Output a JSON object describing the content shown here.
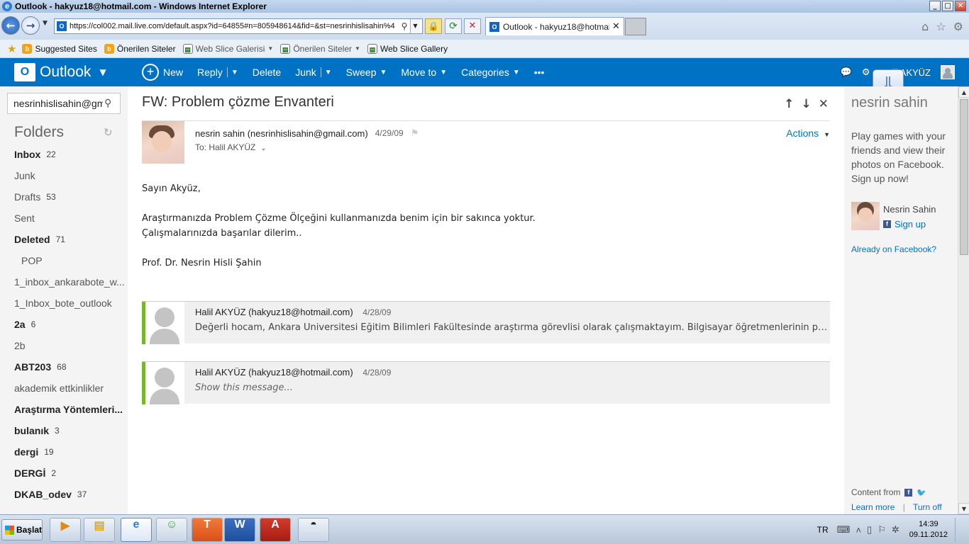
{
  "window": {
    "title": "Outlook - hakyuz18@hotmail.com - Windows Internet Explorer",
    "min": "_",
    "max": "□",
    "close": "✕"
  },
  "browser": {
    "url": "https://col002.mail.live.com/default.aspx?id=64855#n=805948614&fid=&st=nesrinhislisahin%4",
    "tab_label": "Outlook - hakyuz18@hotmail.com",
    "favorites": [
      {
        "label": "Suggested Sites",
        "icon": "bing-icon",
        "dropdown": false
      },
      {
        "label": "Önerilen Siteler",
        "icon": "bing-icon",
        "dropdown": false
      },
      {
        "label": "Web Slice Galerisi",
        "icon": "page-icon",
        "dropdown": true
      },
      {
        "label": "Önerilen Siteler",
        "icon": "page-icon",
        "dropdown": true
      },
      {
        "label": "Web Slice Gallery",
        "icon": "page-icon",
        "dropdown": false
      }
    ]
  },
  "appbar": {
    "brand": "Outlook",
    "commands": {
      "new": "New",
      "reply": "Reply",
      "delete": "Delete",
      "junk": "Junk",
      "sweep": "Sweep",
      "move_to": "Move to",
      "categories": "Categories",
      "more": "•••"
    },
    "user_name": "Halil AKYÜZ",
    "accent_color": "#0072c6"
  },
  "sidebar": {
    "search_value": "nesrinhislisahin@gm",
    "folders_heading": "Folders",
    "folders": [
      {
        "name": "Inbox",
        "count": "22",
        "bold": true
      },
      {
        "name": "Junk",
        "count": "",
        "bold": false
      },
      {
        "name": "Drafts",
        "count": "53",
        "bold": false
      },
      {
        "name": "Sent",
        "count": "",
        "bold": false
      },
      {
        "name": "Deleted",
        "count": "71",
        "bold": true
      },
      {
        "name": "POP",
        "count": "",
        "bold": false,
        "sub": true
      },
      {
        "name": "1_inbox_ankarabote_w...",
        "count": "",
        "bold": false
      },
      {
        "name": "1_Inbox_bote_outlook",
        "count": "",
        "bold": false
      },
      {
        "name": "2a",
        "count": "6",
        "bold": true
      },
      {
        "name": "2b",
        "count": "",
        "bold": false
      },
      {
        "name": "ABT203",
        "count": "68",
        "bold": true
      },
      {
        "name": "akademik ettkinlikler",
        "count": "",
        "bold": false
      },
      {
        "name": "Araştırma Yöntemleri...",
        "count": "",
        "bold": true
      },
      {
        "name": "bulanık",
        "count": "3",
        "bold": true
      },
      {
        "name": "dergi",
        "count": "19",
        "bold": true
      },
      {
        "name": "DERGİ",
        "count": "2",
        "bold": true
      },
      {
        "name": "DKAB_odev",
        "count": "37",
        "bold": true
      }
    ]
  },
  "message": {
    "subject": "FW: Problem çözme Envanteri",
    "from": "nesrin sahin (nesrinhislisahin@gmail.com)",
    "date": "4/29/09",
    "to": "To: Halil AKYÜZ",
    "actions_label": "Actions",
    "body": [
      "Sayın Akyüz,",
      "",
      "Araştırmanızda Problem Çözme Ölçeğini kullanmanızda benim için bir sakınca yoktur.",
      "Çalışmalarınızda başarılar dilerim..",
      "",
      "Prof. Dr. Nesrin Hisli Şahin"
    ],
    "thread": [
      {
        "from": "Halil AKYÜZ (hakyuz18@hotmail.com)",
        "date": "4/28/09",
        "snippet": "Değerli hocam, Ankara Üniversitesi Eğitim Bilimleri Fakültesinde araştırma görevlisi olarak çalışmaktayım. Bilgisayar öğretmenlerinin problem çöz...",
        "italic": false
      },
      {
        "from": "Halil AKYÜZ (hakyuz18@hotmail.com)",
        "date": "4/28/09",
        "snippet": "Show this message...",
        "italic": true
      }
    ]
  },
  "right_pane": {
    "contact_heading": "nesrin sahin",
    "promo": "Play games with your friends and view their photos on Facebook. Sign up now!",
    "contact_name": "Nesrin Sahin",
    "signup": "Sign up",
    "already": "Already on Facebook?",
    "content_from": "Content from",
    "learn_more": "Learn more",
    "separator": "|",
    "turn_off": "Turn off"
  },
  "taskbar": {
    "start_label": "Başlat",
    "apps": [
      "media-player-icon",
      "explorer-icon",
      "internet-explorer-icon",
      "messenger-icon",
      "app-t-icon",
      "word-icon",
      "pdf-icon",
      "app-hat-icon"
    ],
    "lang": "TR",
    "time": "14:39",
    "date": "09.11.2012"
  }
}
